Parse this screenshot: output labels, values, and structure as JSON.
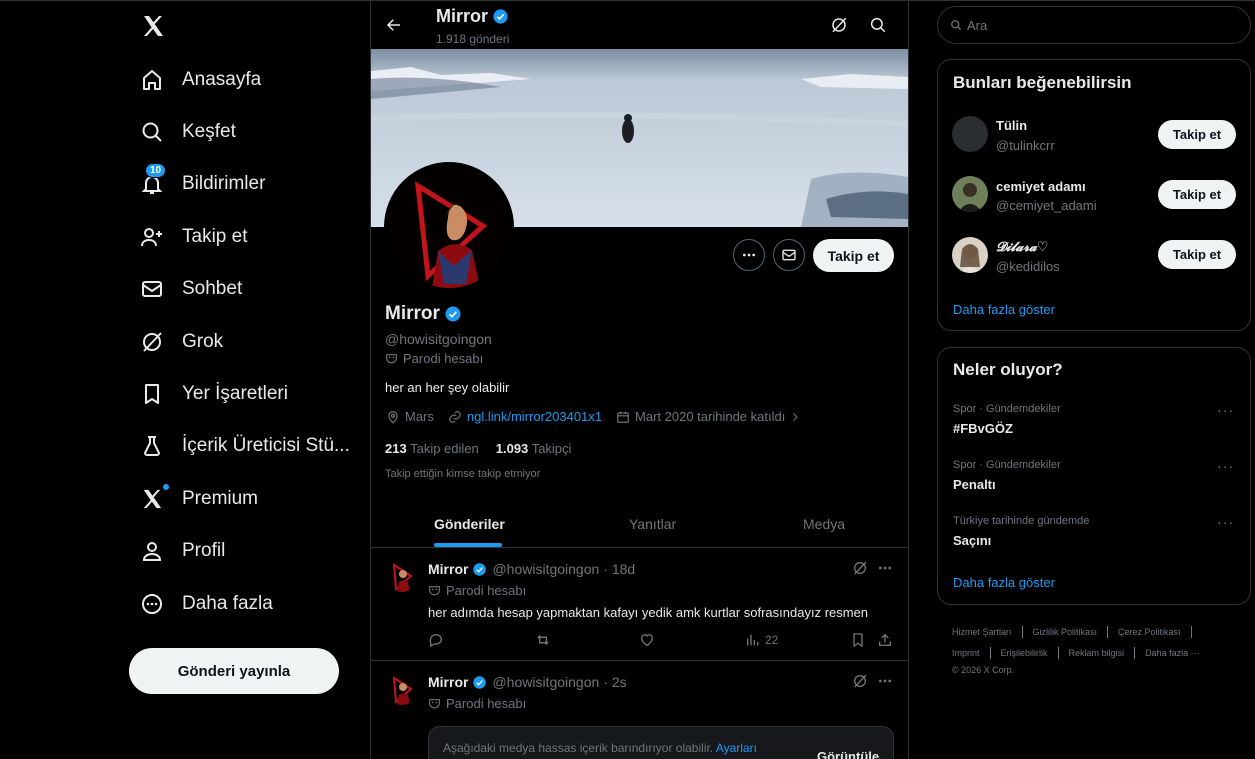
{
  "nav": {
    "items": [
      {
        "label": "Anasayfa",
        "icon": "home-icon"
      },
      {
        "label": "Keşfet",
        "icon": "search-icon"
      },
      {
        "label": "Bildirimler",
        "icon": "bell-icon",
        "badge": "10"
      },
      {
        "label": "Takip et",
        "icon": "add-person-icon"
      },
      {
        "label": "Sohbet",
        "icon": "mail-icon"
      },
      {
        "label": "Grok",
        "icon": "grok-icon"
      },
      {
        "label": "Yer İşaretleri",
        "icon": "bookmark-icon"
      },
      {
        "label": "İçerik Üreticisi Stü...",
        "icon": "flask-icon"
      },
      {
        "label": "Premium",
        "icon": "x-logo-icon"
      },
      {
        "label": "Profil",
        "icon": "person-icon"
      },
      {
        "label": "Daha fazla",
        "icon": "more-circle-icon"
      }
    ],
    "post_button": "Gönderi yayınla"
  },
  "header": {
    "name": "Mirror",
    "post_count": "1.918 gönderi"
  },
  "profile": {
    "name": "Mirror",
    "handle": "@howisitgoingon",
    "parody_label": "Parodi hesabı",
    "bio": "her an her şey olabilir",
    "location": "Mars",
    "link": "ngl.link/mirror203401x1",
    "joined": "Mart 2020 tarihinde katıldı",
    "following_count": "213",
    "following_label": "Takip edilen",
    "followers_count": "1.093",
    "followers_label": "Takipçi",
    "followed_by_note": "Takip ettiğin kimse takip etmiyor",
    "follow_button": "Takip et"
  },
  "tabs": [
    "Gönderiler",
    "Yanıtlar",
    "Medya"
  ],
  "tweets": [
    {
      "name": "Mirror",
      "handle": "@howisitgoingon",
      "time": "· 18d",
      "parody": "Parodi hesabı",
      "text": "her adımda hesap yapmaktan kafayı yedik amk kurtlar sofrasındayız resmen",
      "views": "22"
    },
    {
      "name": "Mirror",
      "handle": "@howisitgoingon",
      "time": "· 2s",
      "parody": "Parodi hesabı",
      "warning": "Aşağıdaki medya hassas içerik barındırıyor olabilir.",
      "warning_link": "Ayarları",
      "warning_button": "Görüntüle"
    }
  ],
  "search": {
    "placeholder": "Ara"
  },
  "suggestions": {
    "title": "Bunları beğenebilirsin",
    "users": [
      {
        "name": "Tülin",
        "handle": "@tulinkcrr",
        "button": "Takip et"
      },
      {
        "name": "cemiyet adamı",
        "handle": "@cemiyet_adami",
        "button": "Takip et"
      },
      {
        "name": "𝓓𝓲𝓵𝓪𝓻𝓪♡",
        "handle": "@kedidilos",
        "button": "Takip et"
      }
    ],
    "show_more": "Daha fazla göster"
  },
  "trends": {
    "title": "Neler oluyor?",
    "items": [
      {
        "category": "Spor · Gündemdekiler",
        "name": "#FBvGÖZ"
      },
      {
        "category": "Spor · Gündemdekiler",
        "name": "Penaltı"
      },
      {
        "category": "Türkiye tarihinde gündemde",
        "name": "Saçını"
      }
    ],
    "show_more": "Daha fazla göster"
  },
  "footer": {
    "row1": [
      "Hizmet Şartları",
      "Gizlilik Politikası",
      "Çerez Politikası"
    ],
    "row2": [
      "Imprint",
      "Erişilebilirlik",
      "Reklam bilgisi",
      "Daha fazla ···"
    ],
    "copyright": "© 2026 X Corp."
  },
  "colors": {
    "accent": "#1d9bf0",
    "background": "#000000",
    "border": "#2f3336",
    "muted": "#71767b"
  }
}
